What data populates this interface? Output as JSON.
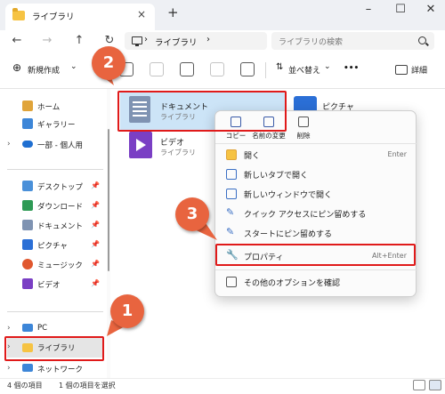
{
  "window": {
    "tab_title": "ライブラリ",
    "tab_close": "×",
    "new_tab": "+",
    "minimize": "–",
    "maximize": "☐",
    "close": "✕"
  },
  "nav": {
    "back": "←",
    "forward": "→",
    "up": "↑",
    "refresh": "↻"
  },
  "address": {
    "chevron": "›",
    "path": "ライブラリ",
    "path_chevron": "›",
    "search_placeholder": "ライブラリの検索"
  },
  "toolbar": {
    "new_label": "新規作成",
    "new_chevron": "⌄",
    "sort_label": "並べ替え",
    "sort_chevron": "⌄",
    "more_label": "•••",
    "details_label": "詳細"
  },
  "sidebar": {
    "items": [
      {
        "label": "ホーム",
        "icon": "home-icon",
        "chev": ""
      },
      {
        "label": "ギャラリー",
        "icon": "gallery-icon",
        "chev": ""
      },
      {
        "label": "一部 - 個人用",
        "icon": "cloud-icon",
        "chev": "›"
      },
      {
        "label": "デスクトップ",
        "icon": "desktop-icon",
        "pin": "📌"
      },
      {
        "label": "ダウンロード",
        "icon": "download-icon",
        "pin": "📌"
      },
      {
        "label": "ドキュメント",
        "icon": "documents-icon",
        "pin": "📌"
      },
      {
        "label": "ピクチャ",
        "icon": "pictures-icon",
        "pin": "📌"
      },
      {
        "label": "ミュージック",
        "icon": "music-icon",
        "pin": "📌"
      },
      {
        "label": "ビデオ",
        "icon": "videos-icon",
        "pin": "📌"
      },
      {
        "label": "PC",
        "icon": "pc-icon",
        "chev": "›"
      },
      {
        "label": "ライブラリ",
        "icon": "library-folder-icon",
        "chev": "›"
      },
      {
        "label": "ネットワーク",
        "icon": "network-icon",
        "chev": "›"
      }
    ]
  },
  "content": {
    "items": [
      {
        "name": "ドキュメント",
        "sub": "ライブラリ"
      },
      {
        "name": "ビデオ",
        "sub": "ライブラリ"
      },
      {
        "name": "ピクチャ",
        "sub": ""
      }
    ]
  },
  "context_menu": {
    "quick": [
      {
        "label": "コピー",
        "icon": "copy-icon"
      },
      {
        "label": "名前の変更",
        "icon": "rename-icon"
      },
      {
        "label": "削除",
        "icon": "delete-icon"
      }
    ],
    "items": [
      {
        "label": "開く",
        "shortcut": "Enter",
        "icon": "open-folder-icon"
      },
      {
        "label": "新しいタブで開く",
        "shortcut": "",
        "icon": "new-tab-icon"
      },
      {
        "label": "新しいウィンドウで開く",
        "shortcut": "",
        "icon": "new-window-icon"
      },
      {
        "label": "クイック アクセスにピン留めする",
        "shortcut": "",
        "icon": "pin-icon"
      },
      {
        "label": "スタートにピン留めする",
        "shortcut": "",
        "icon": "pin-start-icon"
      },
      {
        "label": "プロパティ",
        "shortcut": "Alt+Enter",
        "icon": "wrench-icon"
      },
      {
        "label": "その他のオプションを確認",
        "shortcut": "",
        "icon": "more-options-icon"
      }
    ]
  },
  "callouts": {
    "one": "1",
    "two": "2",
    "three": "3"
  },
  "status": {
    "count": "4 個の項目",
    "selected": "1 個の項目を選択"
  },
  "colors": {
    "highlight": "#e01a1a",
    "callout": "#e8643f",
    "accent": "#3a6fc4"
  }
}
